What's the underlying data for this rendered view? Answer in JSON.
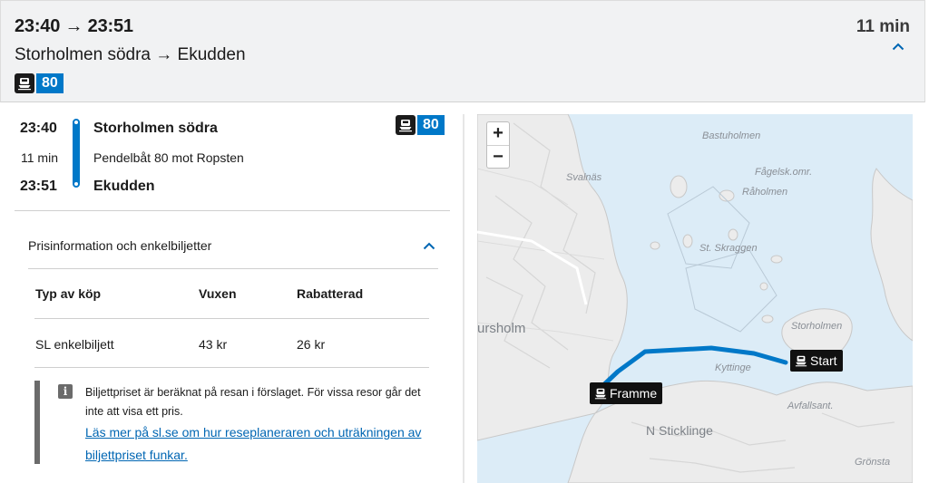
{
  "header": {
    "times": "23:40 → 23:51",
    "route": "Storholmen södra → Ekudden",
    "duration": "11 min",
    "line_badge": "80"
  },
  "leg": {
    "dep_time": "23:40",
    "duration": "11 min",
    "arr_time": "23:51",
    "from_stop": "Storholmen södra",
    "description": "Pendelbåt 80 mot Ropsten",
    "to_stop": "Ekudden",
    "line_badge": "80",
    "line_color": "#0078c8"
  },
  "price": {
    "title": "Prisinformation och enkelbiljetter",
    "columns": [
      "Typ av köp",
      "Vuxen",
      "Rabatterad"
    ],
    "rows": [
      [
        "SL enkelbiljett",
        "43 kr",
        "26 kr"
      ]
    ],
    "info_text": "Biljettpriset är beräknat på resan i förslaget. För vissa resor går det inte att visa ett pris.",
    "info_link": "Läs mer på sl.se om hur reseplaneraren och uträkningen av biljettpriset funkar."
  },
  "map": {
    "zoom_in": "+",
    "zoom_out": "−",
    "labels": {
      "bastuholmen": "Bastuholmen",
      "svalnas": "Svalnäs",
      "fagelsk": "Fågelsk.omr.",
      "raholmen": "Råholmen",
      "st_skraggen": "St. Skraggen",
      "storholmen": "Storholmen",
      "ursholm": "ursholm",
      "kyttinge": "Kyttinge",
      "avfallsant": "Avfallsant.",
      "n_sticklinge": "N Sticklinge",
      "gronsta": "Grönsta"
    },
    "start_label": "Start",
    "end_label": "Framme",
    "route_color": "#0078c8"
  }
}
